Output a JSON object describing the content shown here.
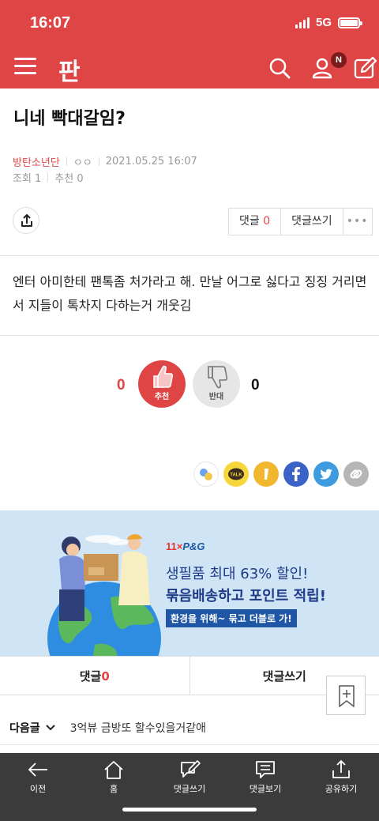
{
  "status_bar": {
    "time": "16:07",
    "network": "5G"
  },
  "header": {
    "logo": "판",
    "notification_badge": "N"
  },
  "post": {
    "title": "니네 빡대갈임?",
    "author": "방탄소년단",
    "author_extra": "ㅇㅇ",
    "datetime": "2021.05.25 16:07",
    "views": "조회 1",
    "recommends": "추천 0",
    "body": "엔터 아미한테 팬톡좀 처가라고 해. 만날 어그로 싫다고 징징 거리면서 지들이 톡차지 다하는거 개웃김"
  },
  "actions": {
    "comment_label": "댓글",
    "comment_count": "0",
    "write_comment": "댓글쓰기",
    "more": "•••"
  },
  "vote": {
    "up_count": "0",
    "up_label": "추천",
    "down_label": "반대",
    "down_count": "0"
  },
  "ad": {
    "brand_11": "11",
    "brand_x": "×",
    "brand_pg": "P&G",
    "line1": "생필품 최대 63% 할인!",
    "line2": "묶음배송하고 포인트 적립!",
    "tag": "환경을 위해~ 묶고 더블로 가!"
  },
  "comment_bar": {
    "comments": "댓글",
    "count": "0",
    "write": "댓글쓰기"
  },
  "next_post": {
    "label": "다음글",
    "title": "3억뷰 금방또 할수있을거같애"
  },
  "bottom_nav": [
    {
      "label": "이전",
      "icon": "back-arrow-icon"
    },
    {
      "label": "홈",
      "icon": "home-icon"
    },
    {
      "label": "댓글쓰기",
      "icon": "write-comment-icon"
    },
    {
      "label": "댓글보기",
      "icon": "view-comments-icon"
    },
    {
      "label": "공유하기",
      "icon": "share-icon"
    }
  ],
  "colors": {
    "brand_red": "#e04545",
    "ad_bg": "#cfe4f5",
    "bottom_bar": "#3b3b3b"
  }
}
